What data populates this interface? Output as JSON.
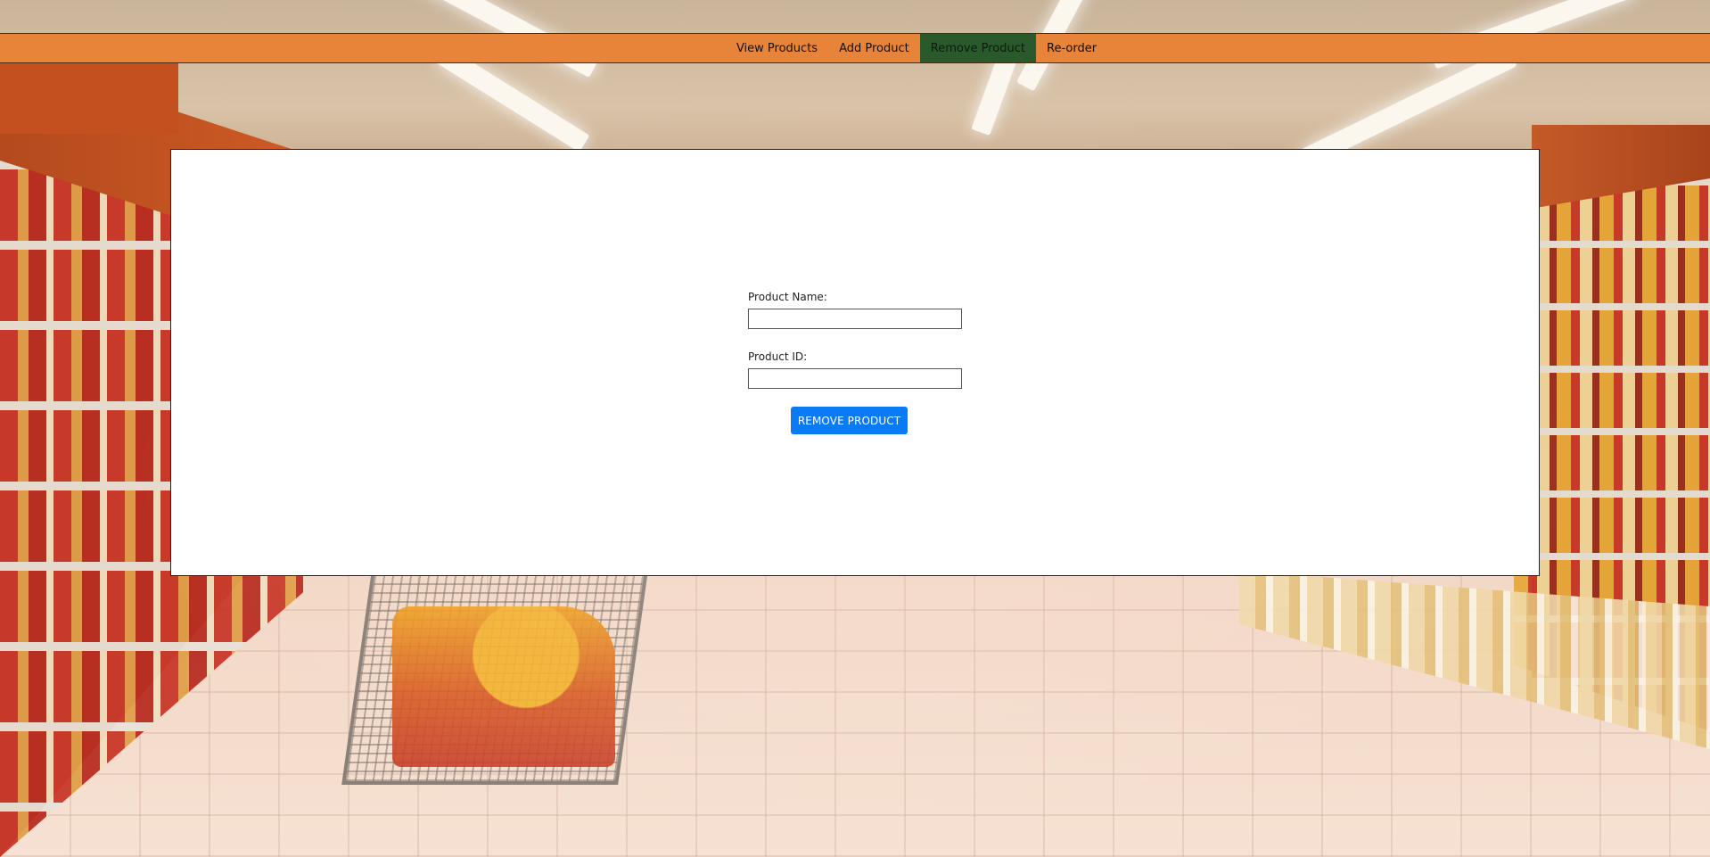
{
  "nav": {
    "items": [
      {
        "label": "View Products",
        "active": false
      },
      {
        "label": "Add Product",
        "active": false
      },
      {
        "label": "Remove Product",
        "active": true
      },
      {
        "label": "Re-order",
        "active": false
      }
    ],
    "active_color": "#2a5a2c",
    "bar_color": "#e8843a"
  },
  "form": {
    "product_name": {
      "label": "Product Name:",
      "value": ""
    },
    "product_id": {
      "label": "Product ID:",
      "value": ""
    },
    "submit_label": "REMOVE PRODUCT",
    "submit_color": "#0a7bf5"
  }
}
